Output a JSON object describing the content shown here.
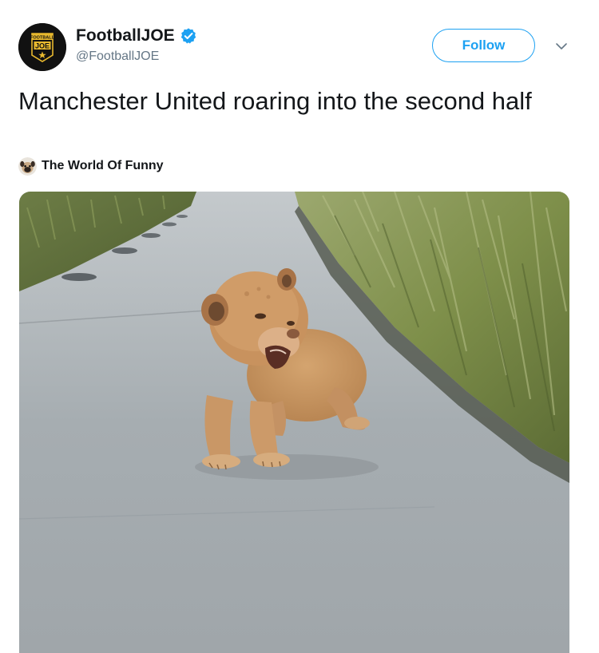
{
  "author": {
    "display_name": "FootballJOE",
    "handle": "@FootballJOE",
    "verified": true,
    "avatar_icon": "footballjoe-logo-icon",
    "avatar_text_top": "FOOTBALL",
    "avatar_text_main": "JOE"
  },
  "actions": {
    "follow_label": "Follow",
    "more_icon": "chevron-down-icon"
  },
  "tweet": {
    "text": "Manchester United roaring into the second half"
  },
  "attribution": {
    "name": "The World Of Funny",
    "avatar_icon": "pug-avatar-icon"
  },
  "media": {
    "type": "video",
    "description_icon": "lion-cub-video-thumbnail"
  },
  "colors": {
    "accent": "#1da1f2",
    "text": "#14171a",
    "secondary_text": "#657786",
    "avatar_bg": "#111111",
    "logo_gold": "#e8b92e"
  }
}
